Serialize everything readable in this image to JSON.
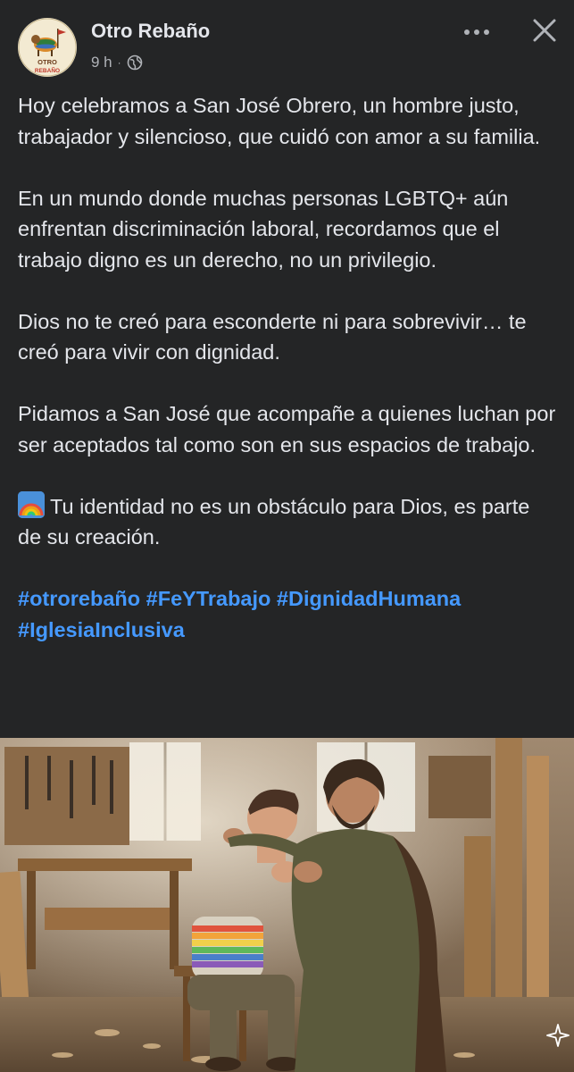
{
  "header": {
    "page_name": "Otro Rebaño",
    "timestamp": "9 h",
    "separator": "·",
    "privacy_icon": "globe-icon",
    "more_icon": "more-horizontal-icon",
    "close_icon": "close-icon",
    "avatar_text": "OTRO REBAÑO"
  },
  "post": {
    "paragraphs": [
      "Hoy celebramos a San José Obrero, un hombre justo, trabajador y silencioso, que cuidó con amor a su familia.",
      "En un mundo donde muchas personas LGBTQ+ aún enfrentan discriminación laboral, recordamos que el trabajo digno es un derecho, no un privilegio.",
      "Dios no te creó para esconderte ni para sobrevivir… te creó para vivir con dignidad.",
      "Pidamos a San José que acompañe a quienes luchan por ser aceptados tal como son en sus espacios de trabajo."
    ],
    "emoji_line": {
      "emoji": "rainbow-emoji",
      "text": "Tu identidad no es un obstáculo para Dios, es parte de su creación."
    },
    "hashtags": [
      "#otrorebaño",
      "#FeYTrabajo",
      "#DignidadHumana",
      "#IglesiaInclusiva"
    ]
  },
  "image": {
    "description_icon": "sparkle-icon"
  },
  "colors": {
    "background": "#242526",
    "text": "#e4e6eb",
    "secondary_text": "#b0b3b8",
    "hashtag": "#4599ff"
  }
}
